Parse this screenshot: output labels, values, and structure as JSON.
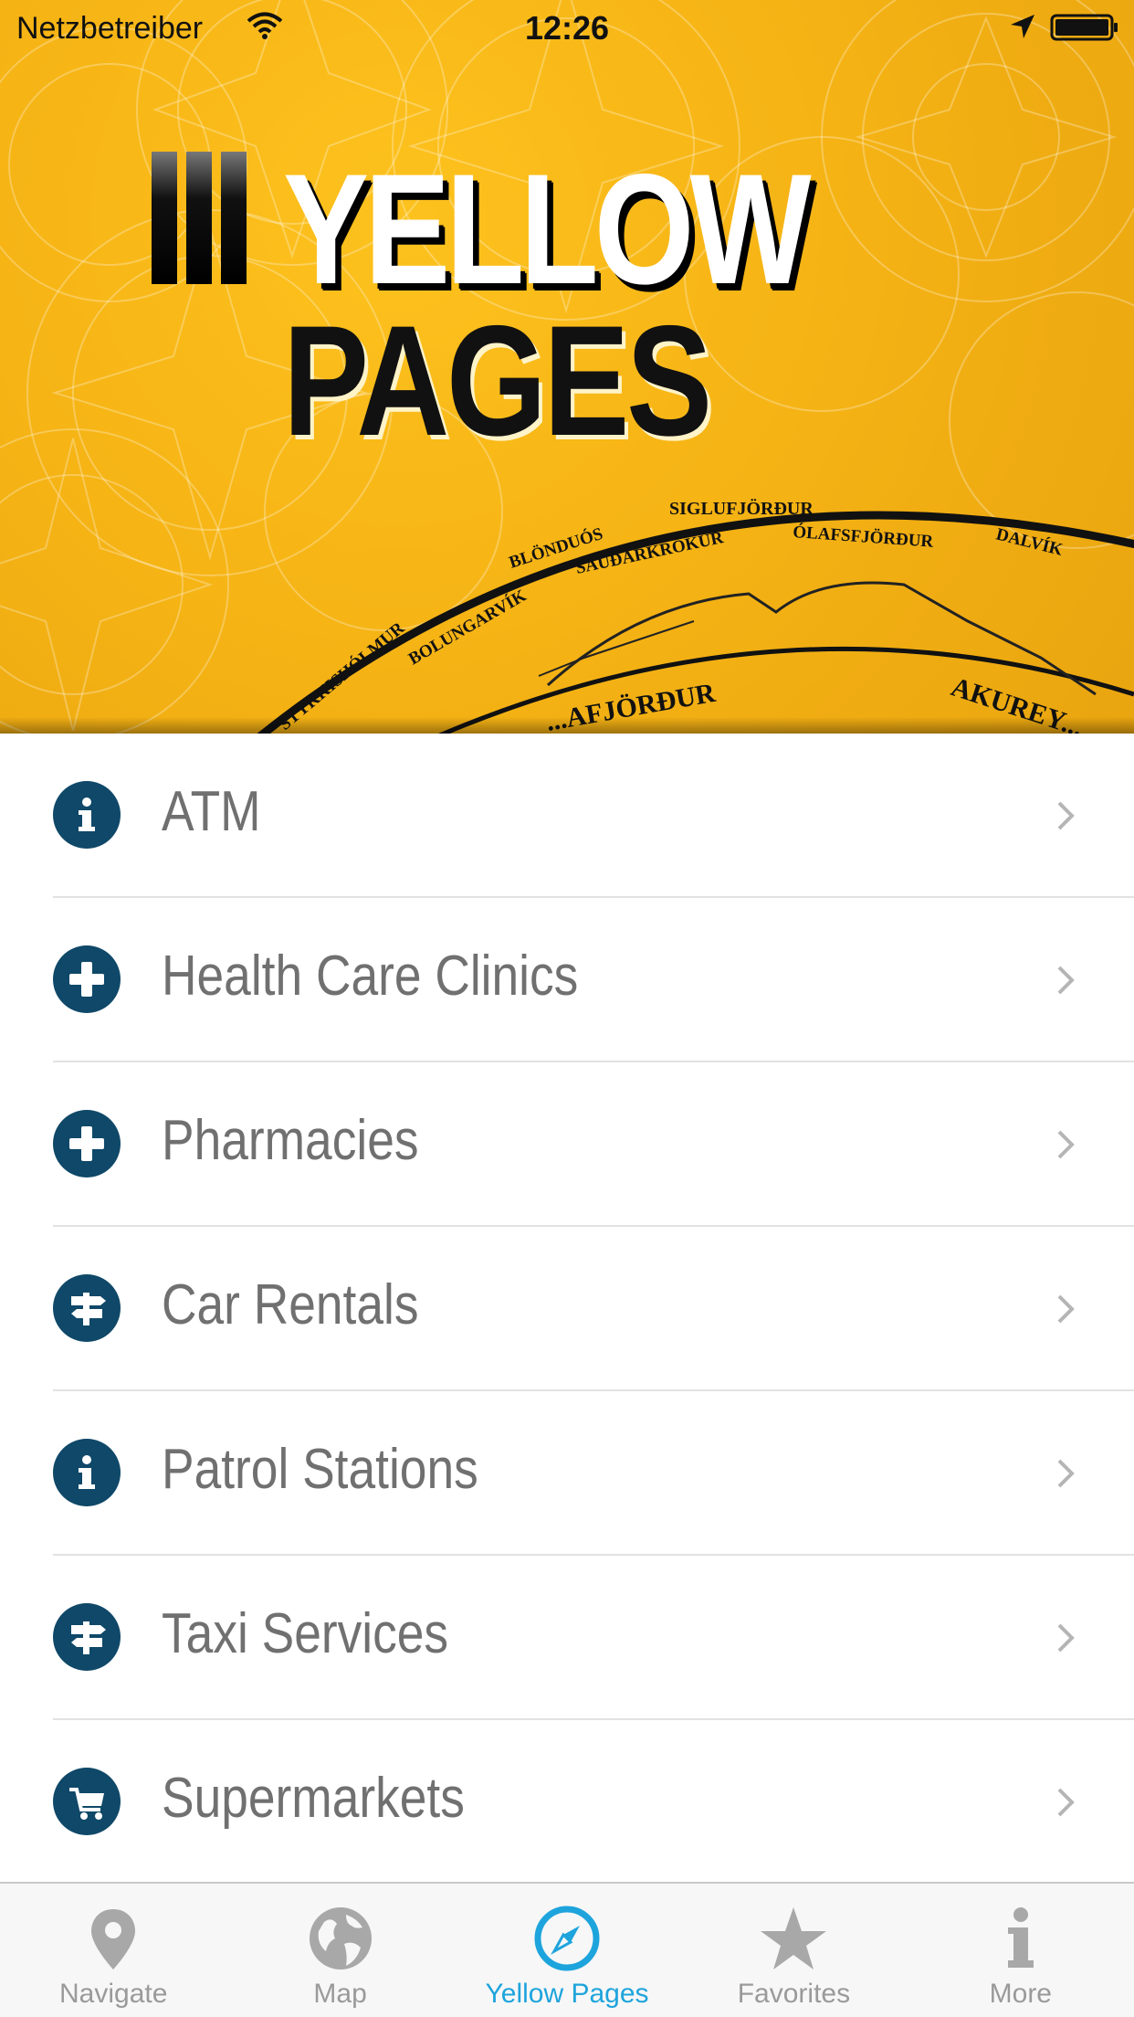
{
  "status_bar": {
    "carrier": "Netzbetreiber",
    "time": "12:26"
  },
  "header": {
    "logo_word_1": "YELLOW",
    "logo_word_2": "PAGES",
    "map_towns": [
      "SIGLUFJÖRÐUR",
      "BLÖNDUÓS",
      "SAUÐÁRKRÓKUR",
      "ÓLAFSFJÖRÐUR",
      "DALVÍK",
      "BOLUNGARVÍK",
      "STYKKISHÓLMUR",
      "...MUR",
      "...AFJÖRÐUR",
      "AKUREY..."
    ],
    "colors": {
      "background": "#f6b415",
      "accent": "#fdc21e"
    }
  },
  "list": {
    "items": [
      {
        "label": "ATM",
        "icon": "info-icon"
      },
      {
        "label": "Health Care Clinics",
        "icon": "plus-icon"
      },
      {
        "label": "Pharmacies",
        "icon": "plus-icon"
      },
      {
        "label": "Car Rentals",
        "icon": "signpost-icon"
      },
      {
        "label": "Patrol Stations",
        "icon": "info-icon"
      },
      {
        "label": "Taxi Services",
        "icon": "signpost-icon"
      },
      {
        "label": "Supermarkets",
        "icon": "cart-icon"
      }
    ],
    "icon_color": "#0f4868",
    "label_color": "#707070"
  },
  "tab_bar": {
    "tabs": [
      {
        "label": "Navigate",
        "icon": "map-pin-icon",
        "active": false
      },
      {
        "label": "Map",
        "icon": "globe-icon",
        "active": false
      },
      {
        "label": "Yellow Pages",
        "icon": "compass-icon",
        "active": true
      },
      {
        "label": "Favorites",
        "icon": "star-icon",
        "active": false
      },
      {
        "label": "More",
        "icon": "info-icon",
        "active": false
      }
    ],
    "active_color": "#1ea4dc",
    "inactive_color": "#9a9a9a"
  }
}
